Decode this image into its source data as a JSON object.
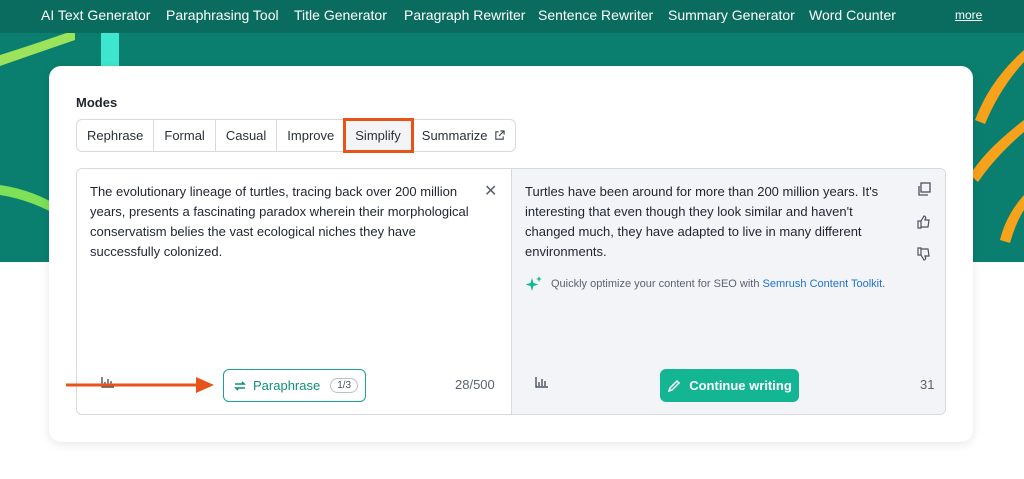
{
  "nav": {
    "items": [
      "AI Text Generator",
      "Paraphrasing Tool",
      "Title Generator",
      "Paragraph Rewriter",
      "Sentence Rewriter",
      "Summary Generator",
      "Word Counter"
    ],
    "more": "more"
  },
  "modes": {
    "label": "Modes",
    "items": [
      "Rephrase",
      "Formal",
      "Casual",
      "Improve",
      "Simplify",
      "Summarize"
    ],
    "active": "Simplify"
  },
  "input": {
    "text": "The evolutionary lineage of turtles, tracing back over 200 million years, presents a fascinating paradox wherein their morphological conservatism belies the vast ecological niches they have successfully colonized.",
    "word_count": "28/500"
  },
  "paraphrase_button": {
    "label": "Paraphrase",
    "counter": "1/3"
  },
  "output": {
    "text": "Turtles have been around for more than 200 million years. It's interesting that even though they look similar and haven't changed much, they have adapted to live in many different environments.",
    "word_count": "31",
    "seo_prefix": "Quickly optimize your content for SEO with ",
    "seo_link": "Semrush Content Toolkit",
    "seo_suffix": "."
  },
  "continue_button": {
    "label": "Continue writing"
  },
  "icons": {
    "clear": "close-icon",
    "stats": "bar-chart-icon",
    "copy": "copy-icon",
    "like": "thumbs-up-icon",
    "dislike": "thumbs-down-icon",
    "sparkle": "sparkle-icon",
    "refresh": "refresh-icon",
    "pencil": "pencil-icon",
    "external": "external-link-icon"
  },
  "colors": {
    "brand_teal": "#0a7f6f",
    "button_green": "#14b593",
    "highlight_orange": "#e8531a",
    "link_blue": "#1f72c4"
  }
}
